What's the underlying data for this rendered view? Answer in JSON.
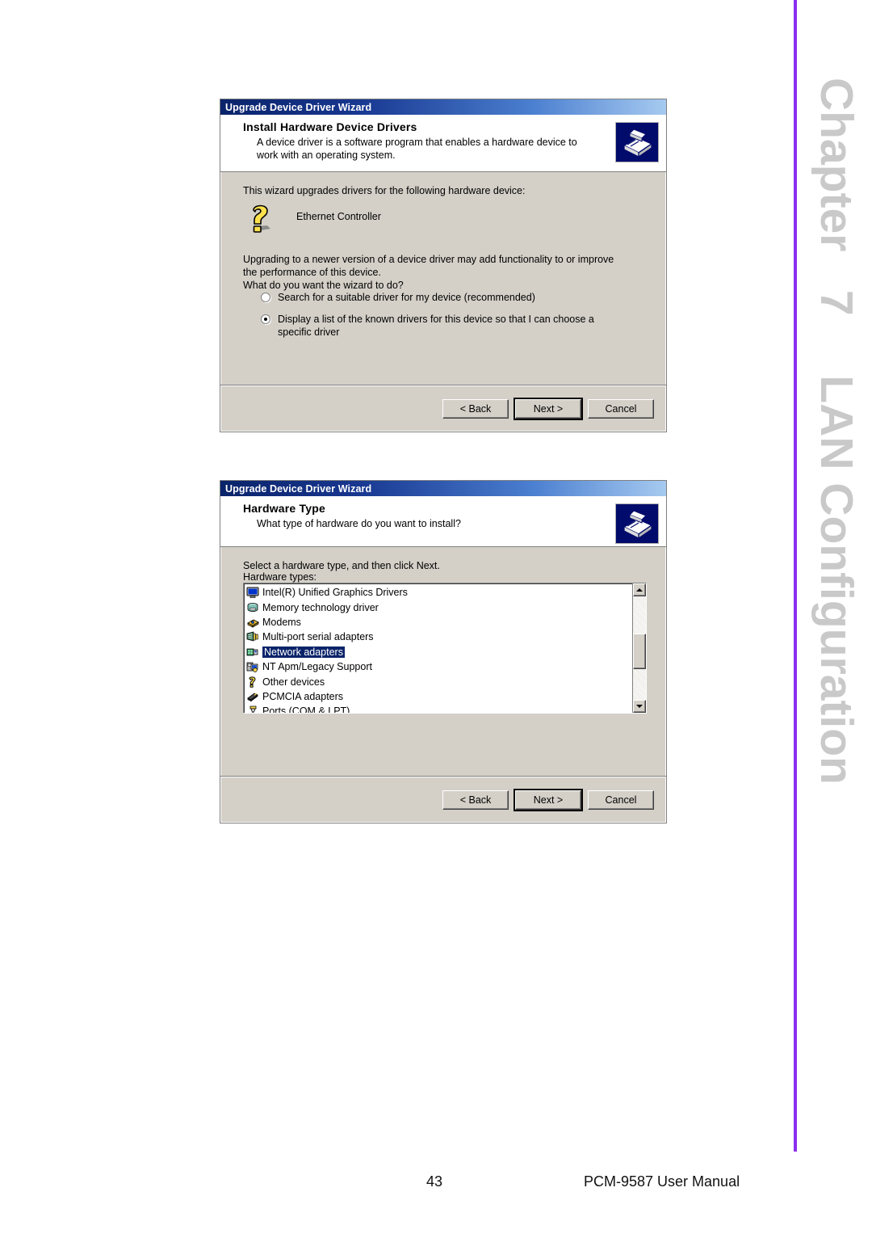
{
  "page": {
    "chapter_label": "Chapter",
    "chapter_number": "7",
    "chapter_title": "LAN Configuration",
    "rule_color": "#8b2ef0",
    "footer_page_number": "43",
    "footer_title": "PCM-9587 User Manual"
  },
  "dialog1": {
    "title": "Upgrade Device Driver Wizard",
    "banner_title": "Install Hardware Device Drivers",
    "banner_sub": "A device driver is a software program that enables a hardware device to work with an operating system.",
    "intro": "This wizard upgrades drivers for the following hardware device:",
    "device_name": "Ethernet Controller",
    "paragraph": "Upgrading to a newer version of a device driver may add functionality to or improve the performance of this device.",
    "question": "What do you want the wizard to do?",
    "options": [
      {
        "label": "Search for a suitable driver for my device (recommended)",
        "selected": false
      },
      {
        "label": "Display a list of the known drivers for this device so that I can choose a specific driver",
        "selected": true
      }
    ],
    "buttons": {
      "back": "< Back",
      "next": "Next >",
      "cancel": "Cancel"
    }
  },
  "dialog2": {
    "title": "Upgrade Device Driver Wizard",
    "banner_title": "Hardware Type",
    "banner_sub": "What type of hardware do you want to install?",
    "instruction": "Select a hardware type, and then click Next.",
    "list_label": "Hardware types:",
    "items": [
      {
        "label": "Intel(R) Unified Graphics Drivers",
        "icon": "monitor-icon",
        "selected": false
      },
      {
        "label": "Memory technology driver",
        "icon": "memory-icon",
        "selected": false
      },
      {
        "label": "Modems",
        "icon": "modem-icon",
        "selected": false
      },
      {
        "label": "Multi-port serial adapters",
        "icon": "serial-adapter-icon",
        "selected": false
      },
      {
        "label": "Network adapters",
        "icon": "network-adapter-icon",
        "selected": true
      },
      {
        "label": "NT Apm/Legacy Support",
        "icon": "legacy-support-icon",
        "selected": false
      },
      {
        "label": "Other devices",
        "icon": "question-mark-icon",
        "selected": false
      },
      {
        "label": "PCMCIA adapters",
        "icon": "pcmcia-icon",
        "selected": false
      },
      {
        "label": "Ports (COM & LPT)",
        "icon": "port-icon",
        "selected": false
      }
    ],
    "buttons": {
      "back": "< Back",
      "next": "Next >",
      "cancel": "Cancel"
    }
  }
}
